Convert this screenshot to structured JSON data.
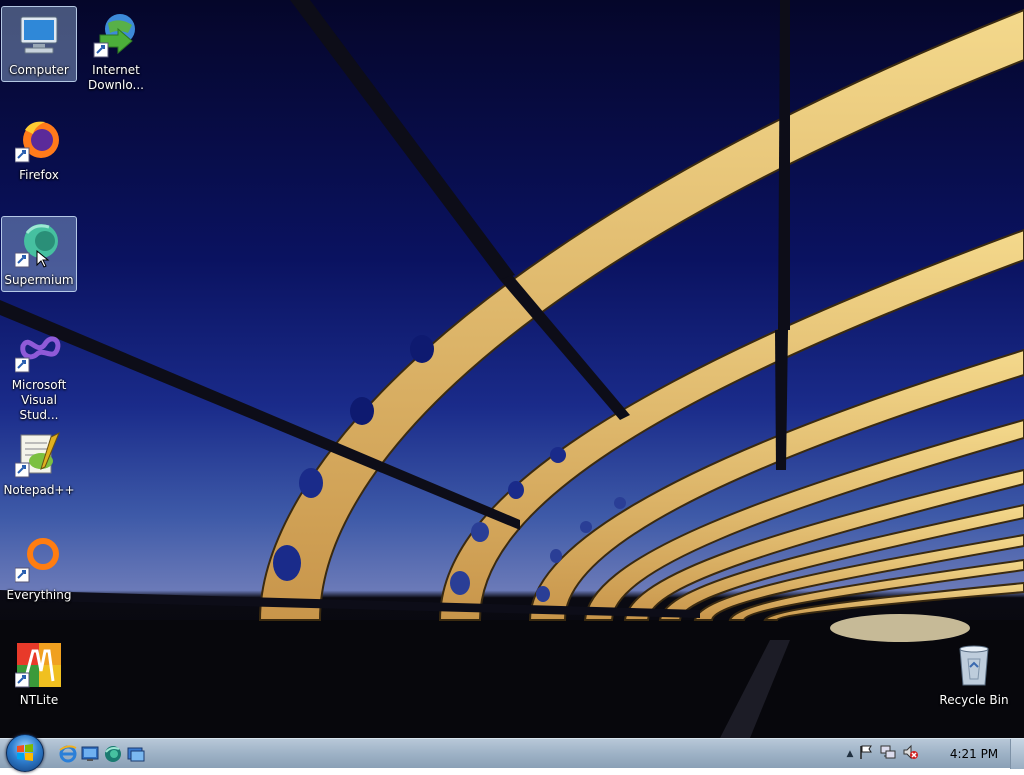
{
  "desktop": {
    "icons": [
      {
        "label": "Computer",
        "icon": "computer-icon",
        "selected": true
      },
      {
        "label": "Internet\nDownlo...",
        "icon": "internet-download-manager-icon",
        "selected": false
      },
      {
        "label": "Firefox",
        "icon": "firefox-icon",
        "selected": false
      },
      {
        "label": "Supermium",
        "icon": "supermium-icon",
        "selected": true
      },
      {
        "label": "Microsoft\nVisual Stud...",
        "icon": "visual-studio-icon",
        "selected": false
      },
      {
        "label": "Notepad++",
        "icon": "notepad-plus-plus-icon",
        "selected": false
      },
      {
        "label": "Everything",
        "icon": "everything-search-icon",
        "selected": false
      },
      {
        "label": "NTLite",
        "icon": "ntlite-icon",
        "selected": false
      },
      {
        "label": "Recycle Bin",
        "icon": "recycle-bin-icon",
        "selected": false
      }
    ]
  },
  "taskbar": {
    "start_icon": "windows-start-orb-icon",
    "quick_launch": [
      "internet-explorer-icon",
      "show-desktop-icon",
      "supermium-icon",
      "window-switcher-icon"
    ],
    "tray_icons": [
      "show-hidden-icons-chevron-icon",
      "action-center-flag-icon",
      "network-icon",
      "volume-muted-icon"
    ],
    "clock": "4:21 PM"
  },
  "colors": {
    "taskbar": "#9eb2c6",
    "selection": "#96b4dc",
    "sky_top": "#05062a",
    "sky_horizon": "#6b7ab8",
    "bridge_gold": "#e8c070"
  }
}
